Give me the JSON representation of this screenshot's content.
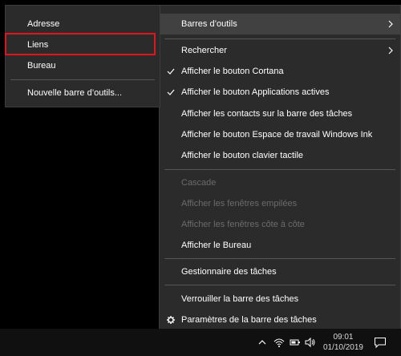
{
  "submenu": {
    "items": [
      {
        "label": "Adresse"
      },
      {
        "label": "Liens"
      },
      {
        "label": "Bureau"
      },
      {
        "label": "Nouvelle barre d’outils..."
      }
    ]
  },
  "context_menu": {
    "items": [
      {
        "label": "Barres d’outils",
        "has_submenu": true,
        "state": "hover"
      },
      {
        "label": "Rechercher",
        "has_submenu": true
      },
      {
        "label": "Afficher le bouton Cortana",
        "checked": true
      },
      {
        "label": "Afficher le bouton Applications actives",
        "checked": true
      },
      {
        "label": "Afficher les contacts sur la barre des tâches"
      },
      {
        "label": "Afficher le bouton Espace de travail Windows Ink"
      },
      {
        "label": "Afficher le bouton clavier tactile"
      },
      {
        "label": "Cascade",
        "disabled": true
      },
      {
        "label": "Afficher les fenêtres empilées",
        "disabled": true
      },
      {
        "label": "Afficher les fenêtres côte à côte",
        "disabled": true
      },
      {
        "label": "Afficher le Bureau"
      },
      {
        "label": "Gestionnaire des tâches"
      },
      {
        "label": "Verrouiller la barre des tâches"
      },
      {
        "label": "Paramètres de la barre des tâches",
        "icon": "gear-icon"
      }
    ]
  },
  "taskbar": {
    "time": "09:01",
    "date": "01/10/2019",
    "tray_icons": [
      "chevron-up-icon",
      "wifi-icon",
      "battery-icon",
      "volume-icon",
      "notification-icon"
    ]
  },
  "colors": {
    "menu_bg": "#2b2b2b",
    "hover_bg": "#414141",
    "highlight_border": "#e0151d",
    "disabled_text": "#6b6b6b"
  }
}
